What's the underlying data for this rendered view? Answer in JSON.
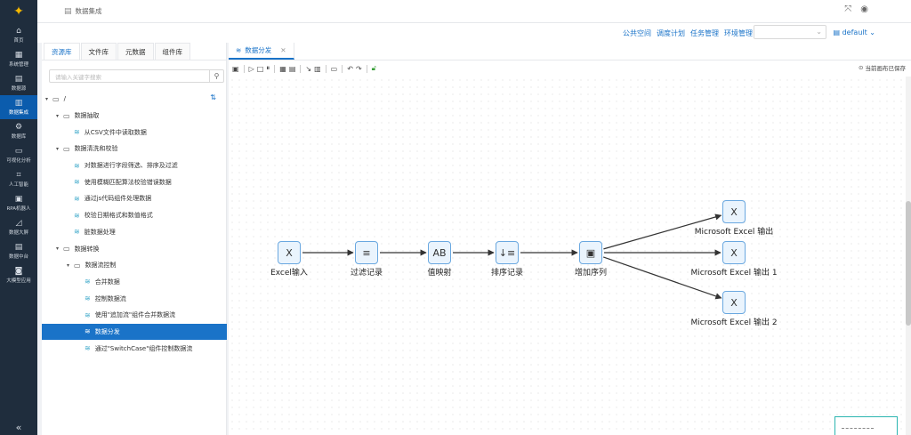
{
  "nav": {
    "items": [
      {
        "label": "首页",
        "icon": "home-icon"
      },
      {
        "label": "系统管理",
        "icon": "grid-icon"
      },
      {
        "label": "数据源",
        "icon": "database-icon"
      },
      {
        "label": "数据集成",
        "icon": "integration-icon"
      },
      {
        "label": "数据库",
        "icon": "db-icon"
      },
      {
        "label": "可视化分析",
        "icon": "monitor-icon"
      },
      {
        "label": "人工智能",
        "icon": "ai-icon"
      },
      {
        "label": "RPA机器人",
        "icon": "robot-icon"
      },
      {
        "label": "数据大屏",
        "icon": "chart-icon"
      },
      {
        "label": "数据中台",
        "icon": "platform-icon"
      },
      {
        "label": "大模型应用",
        "icon": "model-icon"
      }
    ],
    "active_index": 3
  },
  "breadcrumb": {
    "title": "数据集成"
  },
  "header_links": [
    "公共空间",
    "调度计划",
    "任务管理",
    "环境管理"
  ],
  "workspace": {
    "label": "default"
  },
  "panel": {
    "tabs": [
      "资源库",
      "文件库",
      "元数据",
      "组件库"
    ],
    "search_placeholder": "请输入关键字搜索",
    "tree": [
      {
        "label": "/",
        "level": 0,
        "type": "folder"
      },
      {
        "label": "数据抽取",
        "level": 1,
        "type": "folder"
      },
      {
        "label": "从CSV文件中读取数据",
        "level": 2,
        "type": "file"
      },
      {
        "label": "数据清洗和校验",
        "level": 1,
        "type": "folder"
      },
      {
        "label": "对数据进行字段筛选、排序及过滤",
        "level": 2,
        "type": "file"
      },
      {
        "label": "使用模糊匹配算法校验错误数据",
        "level": 2,
        "type": "file"
      },
      {
        "label": "通过js代码组件处理数据",
        "level": 2,
        "type": "file"
      },
      {
        "label": "校验日期格式和数值格式",
        "level": 2,
        "type": "file"
      },
      {
        "label": "脏数据处理",
        "level": 2,
        "type": "file"
      },
      {
        "label": "数据转换",
        "level": 1,
        "type": "folder"
      },
      {
        "label": "数据流控制",
        "level": 2,
        "type": "folder"
      },
      {
        "label": "合并数据",
        "level": 3,
        "type": "file"
      },
      {
        "label": "控制数据流",
        "level": 3,
        "type": "file"
      },
      {
        "label": "使用\"追加流\"组件合并数据流",
        "level": 3,
        "type": "file"
      },
      {
        "label": "数据分发",
        "level": 3,
        "type": "file",
        "selected": true
      },
      {
        "label": "通过\"SwitchCase\"组件控制数据流",
        "level": 3,
        "type": "file"
      }
    ]
  },
  "main": {
    "tab_label": "数据分发",
    "saved_text": "当前画布已保存",
    "nodes": [
      {
        "id": "excel-input",
        "label": "Excel输入",
        "glyph": "X"
      },
      {
        "id": "filter",
        "label": "过滤记录",
        "glyph": "≡"
      },
      {
        "id": "value-map",
        "label": "值映射",
        "glyph": "AB"
      },
      {
        "id": "sort",
        "label": "排序记录",
        "glyph": "↓≡"
      },
      {
        "id": "add-seq",
        "label": "增加序列",
        "glyph": "▣"
      },
      {
        "id": "out0",
        "label": "Microsoft Excel 输出",
        "glyph": "X"
      },
      {
        "id": "out1",
        "label": "Microsoft Excel 输出 1",
        "glyph": "X"
      },
      {
        "id": "out2",
        "label": "Microsoft Excel 输出 2",
        "glyph": "X"
      }
    ]
  },
  "colors": {
    "accent": "#1a73c8",
    "nav_bg": "#1f2d3d",
    "node_border": "#6aa8e0"
  }
}
